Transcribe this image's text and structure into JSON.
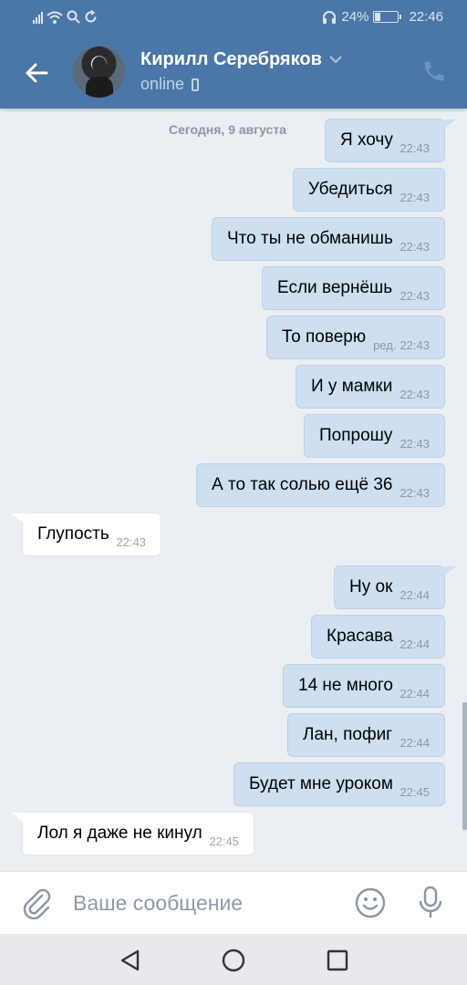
{
  "status_bar": {
    "battery": "24%",
    "battery_level": 0.24,
    "time": "22:46"
  },
  "header": {
    "contact_name": "Кирилл Серебряков",
    "status": "online"
  },
  "chat": {
    "date_separator": "Сегодня, 9 августа",
    "messages": [
      {
        "dir": "out",
        "text": "Я хочу",
        "time": "22:43",
        "edited": ""
      },
      {
        "dir": "out",
        "text": "Убедиться",
        "time": "22:43",
        "edited": ""
      },
      {
        "dir": "out",
        "text": "Что ты не обманишь",
        "time": "22:43",
        "edited": ""
      },
      {
        "dir": "out",
        "text": "Если вернёшь",
        "time": "22:43",
        "edited": ""
      },
      {
        "dir": "out",
        "text": "То поверю",
        "time": "22:43",
        "edited": "ред."
      },
      {
        "dir": "out",
        "text": "И у мамки",
        "time": "22:43",
        "edited": ""
      },
      {
        "dir": "out",
        "text": "Попрошу",
        "time": "22:43",
        "edited": ""
      },
      {
        "dir": "out",
        "text": "А то так солью ещё 36",
        "time": "22:43",
        "edited": ""
      },
      {
        "dir": "in",
        "text": "Глупость",
        "time": "22:43",
        "edited": ""
      },
      {
        "dir": "out",
        "text": "Ну ок",
        "time": "22:44",
        "edited": ""
      },
      {
        "dir": "out",
        "text": "Красава",
        "time": "22:44",
        "edited": ""
      },
      {
        "dir": "out",
        "text": "14 не много",
        "time": "22:44",
        "edited": ""
      },
      {
        "dir": "out",
        "text": "Лан, пофиг",
        "time": "22:44",
        "edited": ""
      },
      {
        "dir": "out",
        "text": "Будет мне уроком",
        "time": "22:45",
        "edited": ""
      },
      {
        "dir": "in",
        "text": "Лол я даже не кинул",
        "time": "22:45",
        "edited": ""
      }
    ]
  },
  "composer": {
    "placeholder": "Ваше сообщение",
    "value": ""
  },
  "colors": {
    "header_bg": "#4a76a8",
    "outgoing_bubble": "#cddff1",
    "incoming_bubble": "#ffffff",
    "chat_bg": "#ebeff4"
  },
  "icons": {
    "back": "arrow-left-icon",
    "call": "phone-icon",
    "attach": "paperclip-icon",
    "emoji": "smiley-icon",
    "mic": "microphone-icon"
  }
}
